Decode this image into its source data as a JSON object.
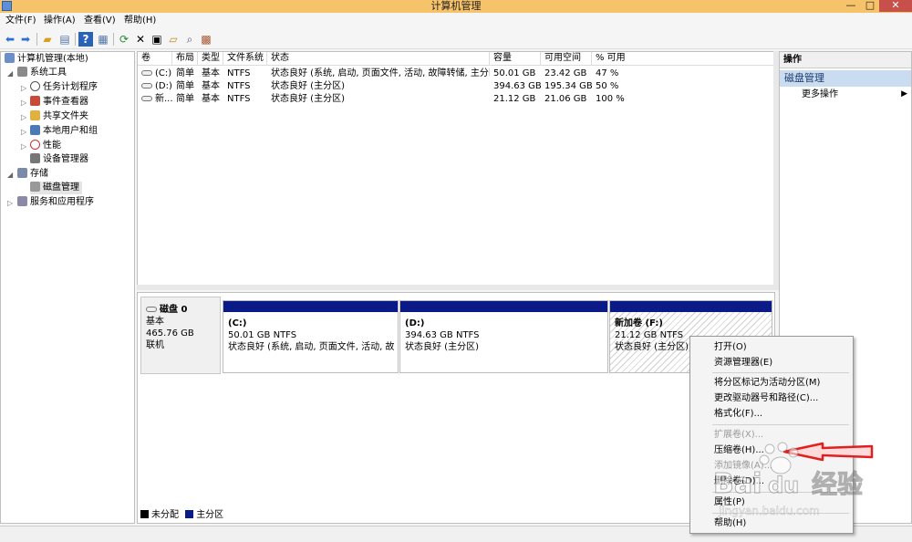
{
  "window": {
    "title": "计算机管理",
    "close": "✕",
    "minimize": "—",
    "maximize": "□"
  },
  "menubar": [
    "文件(F)",
    "操作(A)",
    "查看(V)",
    "帮助(H)"
  ],
  "tree": {
    "root": "计算机管理(本地)",
    "system_tools": "系统工具",
    "task_scheduler": "任务计划程序",
    "event_viewer": "事件查看器",
    "shared_folders": "共享文件夹",
    "local_users": "本地用户和组",
    "performance": "性能",
    "device_manager": "设备管理器",
    "storage": "存储",
    "disk_management": "磁盘管理",
    "services_apps": "服务和应用程序"
  },
  "volume_table": {
    "headers": [
      "卷",
      "布局",
      "类型",
      "文件系统",
      "状态",
      "容量",
      "可用空间",
      "% 可用"
    ],
    "rows": [
      [
        "(C:)",
        "简单",
        "基本",
        "NTFS",
        "状态良好 (系统, 启动, 页面文件, 活动, 故障转储, 主分区)",
        "50.01 GB",
        "23.42 GB",
        "47 %"
      ],
      [
        "(D:)",
        "简单",
        "基本",
        "NTFS",
        "状态良好 (主分区)",
        "394.63 GB",
        "195.34 GB",
        "50 %"
      ],
      [
        "新...",
        "简单",
        "基本",
        "NTFS",
        "状态良好 (主分区)",
        "21.12 GB",
        "21.06 GB",
        "100 %"
      ]
    ]
  },
  "disk0": {
    "name": "磁盘 0",
    "type": "基本",
    "size": "465.76 GB",
    "status": "联机"
  },
  "partitions": [
    {
      "label": "(C:)",
      "size": "50.01 GB NTFS",
      "status": "状态良好 (系统, 启动, 页面文件, 活动, 故障转"
    },
    {
      "label": "(D:)",
      "size": "394.63 GB NTFS",
      "status": "状态良好 (主分区)"
    },
    {
      "label": "新加卷  (F:)",
      "size": "21.12 GB NTFS",
      "status": "状态良好 (主分区)"
    }
  ],
  "legend": {
    "unallocated": "未分配",
    "primary": "主分区"
  },
  "actions": {
    "title": "操作",
    "section": "磁盘管理",
    "more": "更多操作"
  },
  "context_menu": {
    "open": "打开(O)",
    "explorer": "资源管理器(E)",
    "mark_active": "将分区标记为活动分区(M)",
    "change_letter": "更改驱动器号和路径(C)...",
    "format": "格式化(F)...",
    "extend": "扩展卷(X)...",
    "shrink": "压缩卷(H)...",
    "add_mirror": "添加镜像(A)...",
    "delete": "删除卷(D)...",
    "properties": "属性(P)",
    "help": "帮助(H)"
  },
  "watermark": {
    "brand": "Bai",
    "sub": "经验",
    "url": "jingyan.baidu.com"
  },
  "colors": {
    "primary_partition": "#0a1b88",
    "unallocated": "#000000",
    "titlebar": "#f6c26a",
    "arrow": "#e02020"
  }
}
